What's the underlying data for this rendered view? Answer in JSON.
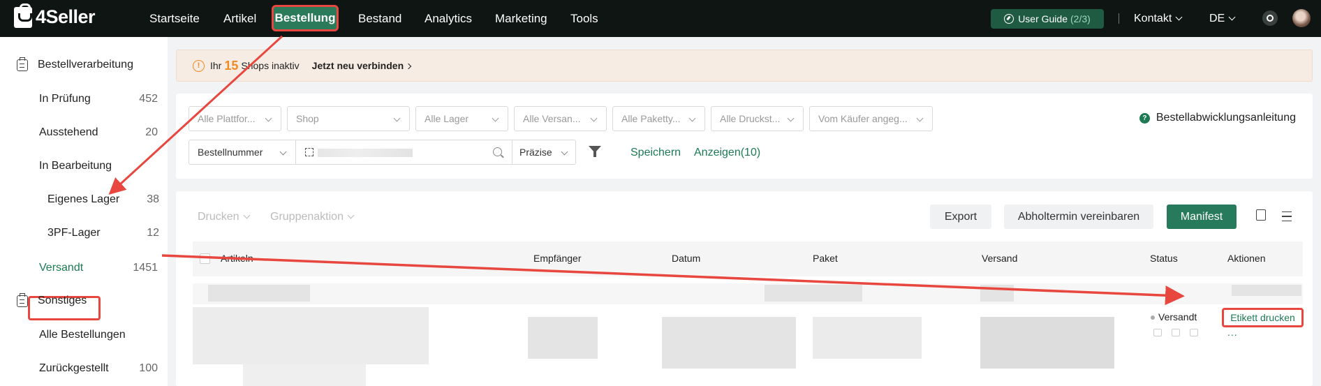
{
  "brand": {
    "name": "4Seller"
  },
  "nav": {
    "items": [
      "Startseite",
      "Artikel",
      "Bestellung",
      "Bestand",
      "Analytics",
      "Marketing",
      "Tools"
    ],
    "active": "Bestellung",
    "guide_label": "User Guide",
    "guide_count": "(2/3)",
    "contact": "Kontakt",
    "language": "DE"
  },
  "sidebar": {
    "group1": "Bestellverarbeitung",
    "items": [
      {
        "label": "In Prüfung",
        "count": "452"
      },
      {
        "label": "Ausstehend",
        "count": "20"
      },
      {
        "label": "In Bearbeitung",
        "count": ""
      },
      {
        "label": "Eigenes Lager",
        "count": "38"
      },
      {
        "label": "3PF-Lager",
        "count": "12"
      },
      {
        "label": "Versandt",
        "count": "1451"
      }
    ],
    "group2": "Sonstiges",
    "items2": [
      {
        "label": "Alle Bestellungen",
        "count": ""
      },
      {
        "label": "Zurückgestellt",
        "count": "100"
      }
    ]
  },
  "notice": {
    "prefix": "Ihr",
    "count": "15",
    "suffix": "Shops inaktiv",
    "link": "Jetzt neu verbinden"
  },
  "filters": {
    "selects": [
      "Alle Plattfor...",
      "Shop",
      "Alle Lager",
      "Alle Versan...",
      "Alle Paketty...",
      "Alle Druckst...",
      "Vom Käufer angeg..."
    ],
    "guide": "Bestellabwicklungsanleitung",
    "search_type": "Bestellnummer",
    "match": "Präzise",
    "save": "Speichern",
    "show": "Anzeigen(10)"
  },
  "toolbar": {
    "print": "Drucken",
    "group": "Gruppenaktion",
    "export": "Export",
    "pickup": "Abholtermin vereinbaren",
    "manifest": "Manifest"
  },
  "table": {
    "headers": [
      "Artikeln",
      "Empfänger",
      "Datum",
      "Paket",
      "Versand",
      "Status",
      "Aktionen"
    ],
    "row": {
      "status": "Versandt",
      "action": "Etikett drucken",
      "more": "..."
    }
  },
  "colors": {
    "accent": "#1d7a55",
    "highlight": "#e8473f",
    "nav_bg": "#0e1512",
    "warning": "#f08a24"
  }
}
